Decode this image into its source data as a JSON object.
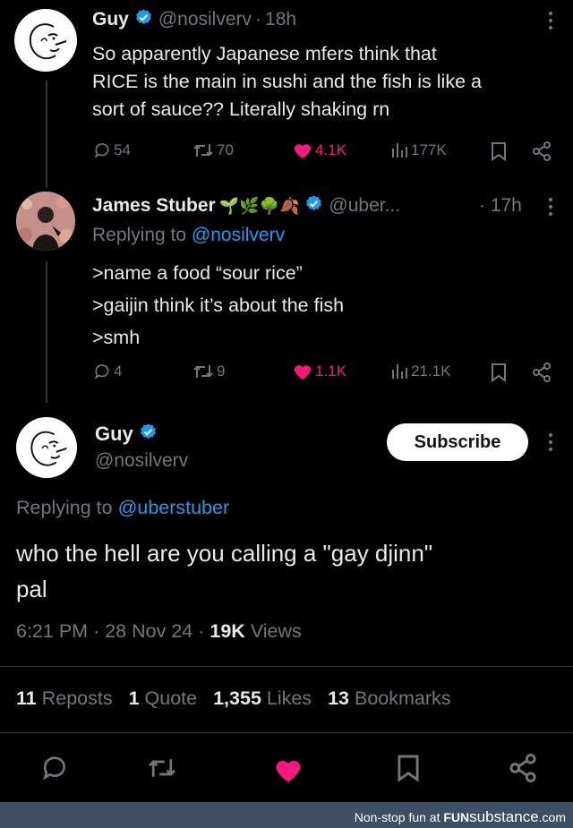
{
  "tweet1": {
    "name": "Guy",
    "handle": "@nosilverv",
    "sep": "·",
    "time": "18h",
    "text_lines": [
      "So apparently Japanese mfers think that",
      "RICE is the main in sushi and the fish is like a",
      "sort of sauce?? Literally shaking rn"
    ],
    "replies": "54",
    "reposts": "70",
    "likes": "4.1K",
    "views": "177K"
  },
  "tweet2": {
    "name": "James Stuber",
    "emojis": "🌱🌿🌳🍂",
    "handle": "@uber...",
    "time": "· 17h",
    "replying_prefix": "Replying to",
    "replying_to": "@nosilverv",
    "text_lines": [
      ">name a food “sour rice”",
      ">gaijin think it’s about the fish",
      ">smh"
    ],
    "replies": "4",
    "reposts": "9",
    "likes": "1.1K",
    "views": "21.1K"
  },
  "main": {
    "name": "Guy",
    "handle": "@nosilverv",
    "subscribe": "Subscribe",
    "replying_prefix": "Replying to",
    "replying_to": "@uberstuber",
    "text_lines": [
      "who the hell are you calling a \"gay djinn\"",
      "pal"
    ],
    "time": "6:21 PM",
    "date": "28 Nov 24",
    "views_count": "19K",
    "views_label": "Views",
    "dot": "·",
    "stats": [
      {
        "count": "11",
        "label": "Reposts"
      },
      {
        "count": "1",
        "label": "Quote"
      },
      {
        "count": "1,355",
        "label": "Likes"
      },
      {
        "count": "13",
        "label": "Bookmarks"
      }
    ]
  },
  "footer": {
    "prefix": "Non-stop fun at",
    "brand_bold": "FUN",
    "brand_rest": "substance",
    "brand_suffix": ".com"
  },
  "colors": {
    "background": "#000000",
    "text": "#e7e9ea",
    "muted": "#71767b",
    "link": "#1d9bf0",
    "like": "#f91880",
    "verified": "#1d9bf0",
    "footer_bg": "#3d4f64"
  },
  "icons": [
    "verified-badge-icon",
    "reply-icon",
    "repost-icon",
    "heart-icon",
    "views-icon",
    "bookmark-icon",
    "share-icon",
    "more-icon"
  ]
}
